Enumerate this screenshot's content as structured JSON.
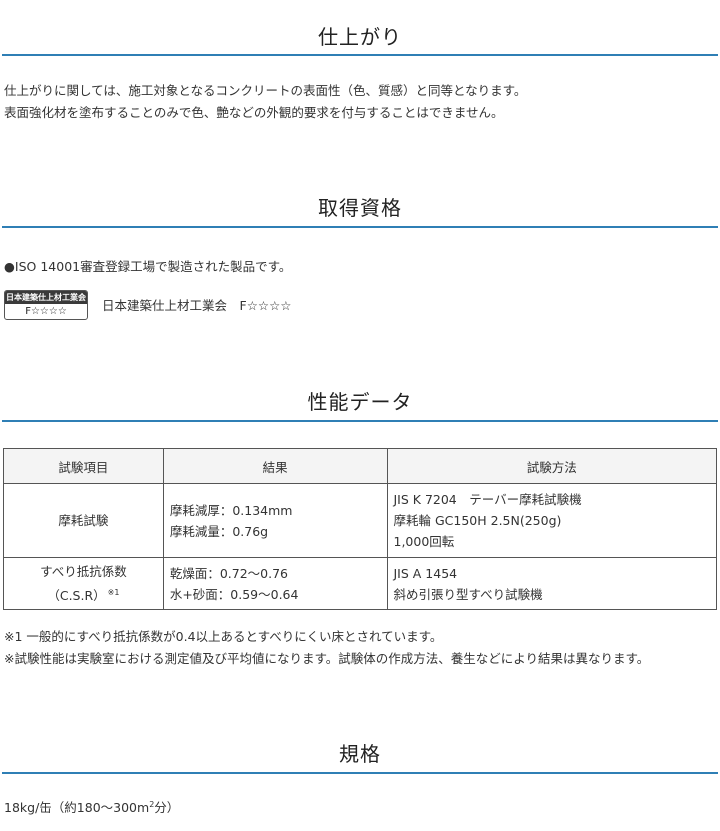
{
  "finish": {
    "title": "仕上がり",
    "lines": [
      "仕上がりに関しては、施工対象となるコンクリートの表面性（色、質感）と同等となります。",
      "表面強化材を塗布することのみで色、艶などの外観的要求を付与することはできません。"
    ]
  },
  "qualification": {
    "title": "取得資格",
    "iso_line": "●ISO 14001審査登録工場で製造された製品です。",
    "badge_top": "日本建築仕上材工業会",
    "badge_bottom": "F☆☆☆☆",
    "badge_label": "日本建築仕上材工業会　F☆☆☆☆"
  },
  "performance": {
    "title": "性能データ",
    "headers": [
      "試験項目",
      "結果",
      "試験方法"
    ],
    "rows": [
      {
        "item": "摩耗試験",
        "item_line2": "",
        "result": [
          "摩耗減厚：0.134mm",
          "摩耗減量：0.76g"
        ],
        "method": [
          "JIS K 7204　テーバー摩耗試験機",
          "摩耗輪 GC150H 2.5N(250g)",
          "1,000回転"
        ]
      },
      {
        "item": "すべり抵抗係数",
        "item_line2": "（C.S.R）",
        "item_note": "※1",
        "result": [
          "乾燥面：0.72～0.76",
          "水+砂面：0.59～0.64"
        ],
        "method": [
          "JIS A 1454",
          "斜め引張り型すべり試験機"
        ]
      }
    ],
    "notes": [
      "※1 一般的にすべり抵抗係数が0.4以上あるとすべりにくい床とされています。",
      "※試験性能は実験室における測定値及び平均値になります。試験体の作成方法、養生などにより結果は異なります。"
    ]
  },
  "spec": {
    "title": "規格",
    "prefix": "18kg/缶（約180～300m",
    "superscript": "2",
    "suffix": "分）"
  },
  "colors": {
    "rule": "#2f7fb5",
    "header_bg": "#f4f4f4",
    "badge_bg": "#3a3a3a"
  }
}
